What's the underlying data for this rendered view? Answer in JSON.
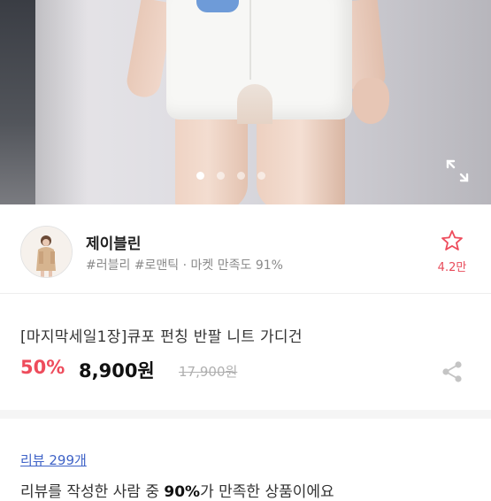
{
  "gallery": {
    "dots": 4,
    "active_index": 0
  },
  "shop": {
    "name": "제이블린",
    "tags": "#러블리 #로맨틱 · 마켓 만족도 91%",
    "favorite_count": "4.2만"
  },
  "product": {
    "title": "[마지막세일1장]큐포 펀칭 반팔 니트 가디건",
    "discount": "50%",
    "price": "8,900원",
    "original_price": "17,900원"
  },
  "reviews": {
    "link_label": "리뷰 299개",
    "summary_prefix": "리뷰를 작성한 사람 중 ",
    "summary_percent": "90%",
    "summary_suffix": "가 만족한 상품이에요"
  },
  "colors": {
    "accent_red": "#ee4c5c",
    "link_blue": "#3f63c7"
  }
}
